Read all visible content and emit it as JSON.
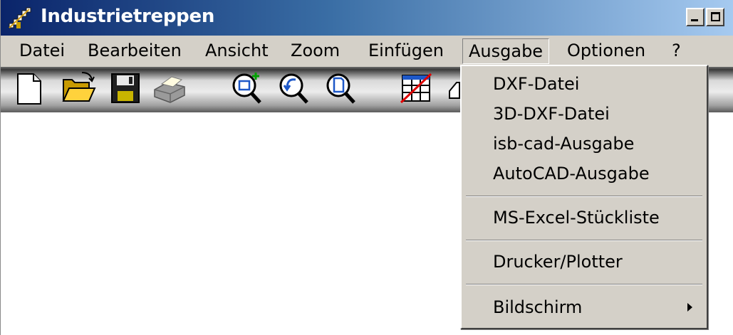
{
  "window": {
    "title": "Industrietreppen",
    "icon": "stairs-app-icon",
    "controls": [
      "minimize-icon",
      "maximize-icon"
    ]
  },
  "menubar": {
    "items": [
      {
        "label": "Datei"
      },
      {
        "label": "Bearbeiten"
      },
      {
        "label": "Ansicht"
      },
      {
        "label": "Zoom"
      },
      {
        "label": "Einfügen"
      },
      {
        "label": "Ausgabe",
        "open": true
      },
      {
        "label": "Optionen"
      },
      {
        "label": "?"
      }
    ]
  },
  "toolbar": {
    "buttons": [
      {
        "icon": "new-document-icon"
      },
      {
        "icon": "open-folder-icon"
      },
      {
        "icon": "save-floppy-icon"
      },
      {
        "icon": "print-icon"
      },
      {
        "icon": "zoom-in-icon"
      },
      {
        "icon": "zoom-previous-icon"
      },
      {
        "icon": "zoom-page-icon"
      },
      {
        "icon": "grid-toggle-icon"
      },
      {
        "icon": "partially-hidden-tool-icon"
      }
    ]
  },
  "ausgabe_menu": {
    "groups": [
      [
        "DXF-Datei",
        "3D-DXF-Datei",
        "isb-cad-Ausgabe",
        "AutoCAD-Ausgabe"
      ],
      [
        "MS-Excel-Stückliste"
      ],
      [
        "Drucker/Plotter"
      ],
      [
        "Bildschirm"
      ]
    ],
    "items": [
      {
        "label": "DXF-Datei"
      },
      {
        "label": "3D-DXF-Datei"
      },
      {
        "label": "isb-cad-Ausgabe"
      },
      {
        "label": "AutoCAD-Ausgabe"
      },
      {
        "label": "MS-Excel-Stückliste"
      },
      {
        "label": "Drucker/Plotter"
      },
      {
        "label": "Bildschirm",
        "submenu": true
      }
    ]
  },
  "colors": {
    "titlebar_start": "#0a246a",
    "titlebar_end": "#a6caf0",
    "menu_face": "#d4d0c8"
  }
}
